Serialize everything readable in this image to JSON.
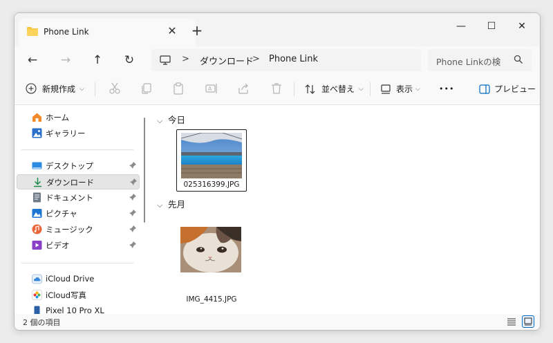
{
  "window": {
    "tab_title": "Phone Link",
    "close_tab_glyph": "✕",
    "new_tab_glyph": "+",
    "minimize_glyph": "—",
    "maximize_glyph": "☐",
    "close_glyph": "✕"
  },
  "navigation": {
    "back_glyph": "←",
    "forward_glyph": "→",
    "up_glyph": "↑",
    "refresh_glyph": "↻",
    "breadcrumb": [
      "ダウンロード",
      "Phone Link"
    ],
    "separator": ">"
  },
  "search": {
    "placeholder": "Phone Linkの検"
  },
  "toolbar": {
    "new_label": "新規作成",
    "sort_label": "並べ替え",
    "view_label": "表示",
    "more_label": "•••",
    "preview_label": "プレビュー",
    "dropdown_glyph": "⌵"
  },
  "sidebar": {
    "top_items": [
      {
        "label": "ホーム",
        "icon": "home-icon"
      },
      {
        "label": "ギャラリー",
        "icon": "gallery-icon"
      }
    ],
    "pinned_items": [
      {
        "label": "デスクトップ",
        "icon": "desktop-icon"
      },
      {
        "label": "ダウンロード",
        "icon": "download-icon",
        "selected": true
      },
      {
        "label": "ドキュメント",
        "icon": "document-icon"
      },
      {
        "label": "ピクチャ",
        "icon": "pictures-icon"
      },
      {
        "label": "ミュージック",
        "icon": "music-icon"
      },
      {
        "label": "ビデオ",
        "icon": "video-icon"
      }
    ],
    "cloud_items": [
      {
        "label": "iCloud Drive",
        "icon": "icloud-drive-icon"
      },
      {
        "label": "iCloud写真",
        "icon": "icloud-photos-icon"
      },
      {
        "label": "Pixel 10 Pro XL",
        "icon": "phone-icon"
      }
    ]
  },
  "content": {
    "groups": [
      {
        "header": "今日",
        "files": [
          {
            "name": "025316399.JPG",
            "selected": true
          }
        ]
      },
      {
        "header": "先月",
        "files": [
          {
            "name": "IMG_4415.JPG",
            "selected": false
          }
        ]
      }
    ]
  },
  "status": {
    "item_count": "2 個の項目"
  },
  "colors": {
    "accent": "#0067c0",
    "folder": "#f7c544",
    "selection": "#e5e5e5"
  }
}
